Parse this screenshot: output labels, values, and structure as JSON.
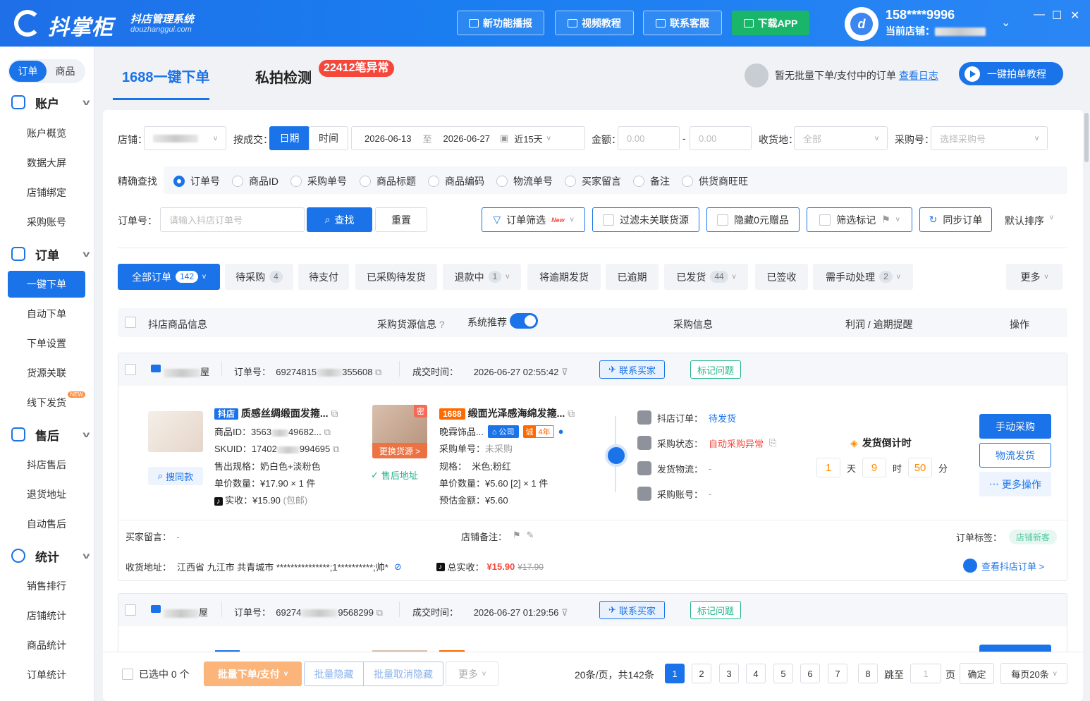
{
  "header": {
    "brand": "抖掌柜",
    "brand_sub": "抖店管理系统",
    "brand_domain": "douzhanggui.com",
    "buttons": [
      "新功能播报",
      "视频教程",
      "联系客服",
      "下载APP"
    ],
    "phone": "158****9996",
    "current_shop_label": "当前店铺："
  },
  "sidebar": {
    "seg": [
      "订单",
      "商品"
    ],
    "groups": [
      {
        "label": "账户",
        "items": [
          "账户概览",
          "数据大屏",
          "店铺绑定",
          "采购账号"
        ]
      },
      {
        "label": "订单",
        "items": [
          "一键下单",
          "自动下单",
          "下单设置",
          "货源关联",
          "线下发货"
        ]
      },
      {
        "label": "售后",
        "items": [
          "抖店售后",
          "退货地址",
          "自动售后"
        ]
      },
      {
        "label": "统计",
        "items": [
          "销售排行",
          "店铺统计",
          "商品统计",
          "订单统计"
        ]
      }
    ],
    "new_tag": "NEW"
  },
  "tabs": {
    "tab1": "1688一键下单",
    "tab2": "私拍检测",
    "tab2_badge": "22412笔异常",
    "note": "暂无批量下单/支付中的订单",
    "note_link": "查看日志",
    "tutorial": "一键拍单教程"
  },
  "filters": {
    "shop_label": "店铺：",
    "deal_label": "按成交：",
    "date_btn": "日期",
    "time_btn": "时间",
    "date_from": "2026-06-13",
    "date_to_sep": "至",
    "date_to": "2026-06-27",
    "range": "近15天",
    "amount_label": "金额：",
    "amount_min": "0.00",
    "amount_sep": "-",
    "amount_max": "0.00",
    "ship_label": "收货地：",
    "ship_value": "全部",
    "purchase_label": "采购号：",
    "purchase_placeholder": "选择采购号",
    "exact_label": "精确查找",
    "radios": [
      "订单号",
      "商品ID",
      "采购单号",
      "商品标题",
      "商品编码",
      "物流单号",
      "买家留言",
      "备注",
      "供货商旺旺"
    ],
    "order_label": "订单号：",
    "order_placeholder": "请输入抖店订单号",
    "search": "查找",
    "reset": "重置",
    "order_filter": "订单筛选",
    "new": "New",
    "f1": "过滤未关联货源",
    "f2": "隐藏0元赠品",
    "f3": "筛选标记",
    "sync": "同步订单",
    "sort": "默认排序"
  },
  "status_tabs": [
    {
      "label": "全部订单",
      "count": "142"
    },
    {
      "label": "待采购",
      "count": "4"
    },
    {
      "label": "待支付",
      "count": ""
    },
    {
      "label": "已采购待发货",
      "count": ""
    },
    {
      "label": "退款中",
      "count": "1"
    },
    {
      "label": "将逾期发货",
      "count": ""
    },
    {
      "label": "已逾期",
      "count": ""
    },
    {
      "label": "已发货",
      "count": "44"
    },
    {
      "label": "已签收",
      "count": ""
    },
    {
      "label": "需手动处理",
      "count": "2"
    },
    {
      "label": "更多",
      "count": ""
    }
  ],
  "table_head": {
    "c1": "抖店商品信息",
    "c2": "采购货源信息",
    "c3": "系统推荐",
    "c4": "采购信息",
    "c5": "利润 / 逾期提醒",
    "c6": "操作"
  },
  "order1": {
    "shop_suffix": "屋",
    "order_no_label": "订单号：",
    "order_no_a": "69274815",
    "order_no_b": "355608",
    "deal_label": "成交时间：",
    "deal_time": "2026-06-27 02:55:42",
    "contact": "联系买家",
    "mark": "标记问题",
    "src_tag": "抖店",
    "title": "质感丝绸缎面发箍...",
    "pid_label": "商品ID：",
    "pid_a": "3563",
    "pid_b": "49682...",
    "sku_label": "SKUID：",
    "sku_a": "17402",
    "sku_b": "994695",
    "spec_label": "售出规格：",
    "spec": "奶白色+淡粉色",
    "qty_label": "单价数量：",
    "qty": "¥17.90 × 1 件",
    "paid_label": "实收：",
    "paid": "¥15.90",
    "paid_note": "(包邮)",
    "search_same": "搜同款",
    "secret": "密",
    "change_src": "更换货源 >",
    "after_addr": "售后地址",
    "p_tag": "1688",
    "p_title": "缎面光泽感海绵发箍...",
    "supplier": "晚霖饰品...",
    "company": "公司",
    "cheng": "诚",
    "years": "4年",
    "p_no_label": "采购单号：",
    "p_no": "未采购",
    "p_spec_label": "规格：",
    "p_spec": "米色;粉红",
    "p_qty_label": "单价数量：",
    "p_qty": "¥5.60 [2] × 1 件",
    "p_est_label": "预估金额：",
    "p_est": "¥5.60",
    "s1_label": "抖店订单：",
    "s1": "待发货",
    "s2_label": "采购状态：",
    "s2": "自动采购异常",
    "s3_label": "发货物流：",
    "s3": "-",
    "s4_label": "采购账号：",
    "s4": "-",
    "countdown_title": "发货倒计时",
    "cd_d": "1",
    "cd_d_u": "天",
    "cd_h": "9",
    "cd_h_u": "时",
    "cd_m": "50",
    "cd_m_u": "分",
    "act1": "手动采购",
    "act2": "物流发货",
    "act3": "更多操作",
    "buyer_msg_label": "买家留言：",
    "buyer_msg": "-",
    "shop_note_label": "店铺备注：",
    "tag_label": "订单标签：",
    "tag": "店铺新客",
    "addr_label": "收货地址：",
    "addr": "江西省 九江市 共青城市 ***************;1**********;帅*",
    "total_label": "总实收：",
    "total": "¥15.90",
    "total_old": "¥17.90",
    "view_order": "查看抖店订单 >"
  },
  "order2": {
    "shop_suffix": "屋",
    "order_no_label": "订单号：",
    "order_no_a": "69274",
    "order_no_b": "9568299",
    "deal_label": "成交时间：",
    "deal_time": "2026-06-27 01:29:56",
    "contact": "联系买家",
    "mark": "标记问题"
  },
  "footer": {
    "selected": "已选中 0 个",
    "batch": "批量下单/支付",
    "hide": "批量隐藏",
    "unhide": "批量取消隐藏",
    "more": "更多",
    "summary": "20条/页，共142条",
    "pages": [
      "1",
      "2",
      "3",
      "4",
      "5",
      "6",
      "7",
      "8"
    ],
    "jump": "跳至",
    "jump_val": "1",
    "page_unit": "页",
    "confirm": "确定",
    "per_page": "每页20条"
  }
}
